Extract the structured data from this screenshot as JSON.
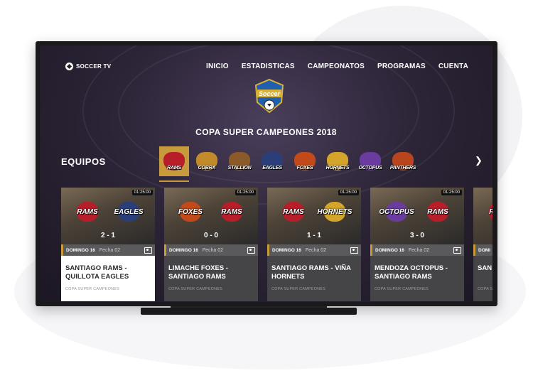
{
  "app": {
    "logo_text": "SOCCER TV"
  },
  "nav": {
    "items": [
      "INICIO",
      "ESTADISTICAS",
      "CAMPEONATOS",
      "PROGRAMAS",
      "CUENTA"
    ]
  },
  "tournament": {
    "emblem_text": "Soccer",
    "title": "COPA SUPER CAMPEONES 2018"
  },
  "teams_section": {
    "label": "EQUIPOS",
    "teams": [
      {
        "name": "RAMS",
        "color": "#b81e2a",
        "selected": true
      },
      {
        "name": "COBRA",
        "color": "#c28a2a",
        "selected": false
      },
      {
        "name": "STALLION",
        "color": "#8a5a2a",
        "selected": false
      },
      {
        "name": "EAGLES",
        "color": "#2a3f7a",
        "selected": false
      },
      {
        "name": "FOXES",
        "color": "#c24a1a",
        "selected": false
      },
      {
        "name": "HORNETS",
        "color": "#d4a52a",
        "selected": false
      },
      {
        "name": "OCTOPUS",
        "color": "#6b3ca0",
        "selected": false
      },
      {
        "name": "PANTHERS",
        "color": "#b8451e",
        "selected": false
      }
    ]
  },
  "matches": [
    {
      "home": "RAMS",
      "away": "EAGLES",
      "home_color": "#b81e2a",
      "away_color": "#2a3f7a",
      "score": "2 - 1",
      "duration": "01:25:00",
      "day": "DOMINGO 16",
      "fecha": "Fecha 02",
      "title": "SANTIAGO RAMS - QUILLOTA EAGLES",
      "competition": "COPA SUPER CAMPEONES",
      "active": true
    },
    {
      "home": "FOXES",
      "away": "RAMS",
      "home_color": "#c24a1a",
      "away_color": "#b81e2a",
      "score": "0 - 0",
      "duration": "01:25:00",
      "day": "DOMINGO 16",
      "fecha": "Fecha 02",
      "title": "LIMACHE FOXES - SANTIAGO RAMS",
      "competition": "COPA SUPER CAMPEONES",
      "active": false
    },
    {
      "home": "RAMS",
      "away": "HORNETS",
      "home_color": "#b81e2a",
      "away_color": "#d4a52a",
      "score": "1 - 1",
      "duration": "01:25:00",
      "day": "DOMINGO 16",
      "fecha": "Fecha 02",
      "title": "SANTIAGO RAMS - VIÑA HORNETS",
      "competition": "COPA SUPER CAMPEONES",
      "active": false
    },
    {
      "home": "OCTOPUS",
      "away": "RAMS",
      "home_color": "#6b3ca0",
      "away_color": "#b81e2a",
      "score": "3 - 0",
      "duration": "01:25:00",
      "day": "DOMINGO 16",
      "fecha": "Fecha 02",
      "title": "MENDOZA OCTOPUS - SANTIAGO RAMS",
      "competition": "COPA SUPER CAMPEONES",
      "active": false
    },
    {
      "home": "RAMS",
      "away": "",
      "home_color": "#b81e2a",
      "away_color": "#444444",
      "score": "",
      "duration": "",
      "day": "DOMI",
      "fecha": "",
      "title": "SAN QUIL",
      "competition": "COPA S",
      "active": false
    }
  ]
}
